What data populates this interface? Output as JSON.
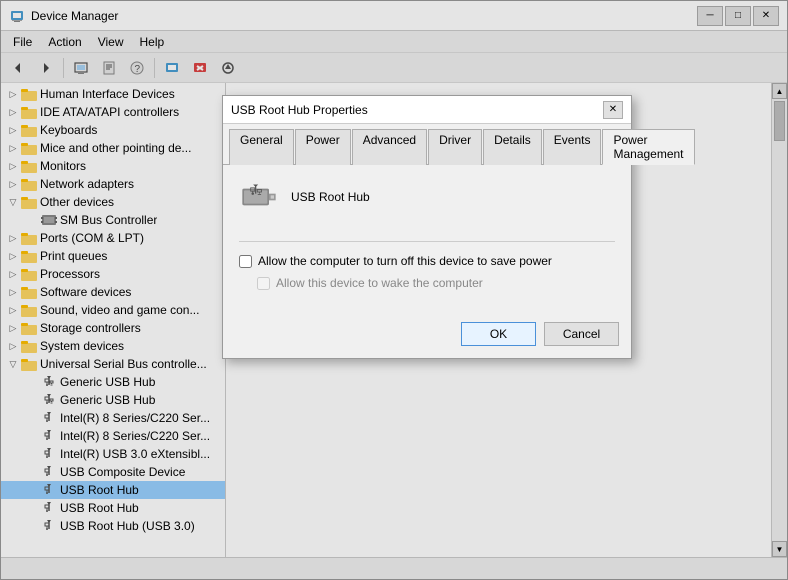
{
  "window": {
    "title": "Device Manager",
    "controls": {
      "minimize": "─",
      "maximize": "□",
      "close": "✕"
    }
  },
  "menu": {
    "items": [
      "File",
      "Action",
      "View",
      "Help"
    ]
  },
  "toolbar": {
    "buttons": [
      "◀",
      "▶",
      "📋",
      "📋",
      "❓",
      "📋",
      "📋",
      "🖥",
      "✕",
      "⬇"
    ]
  },
  "tree": {
    "items": [
      {
        "label": "Human Interface Devices",
        "indent": 1,
        "expanded": false,
        "icon": "folder"
      },
      {
        "label": "IDE ATA/ATAPI controllers",
        "indent": 1,
        "expanded": false,
        "icon": "folder"
      },
      {
        "label": "Keyboards",
        "indent": 1,
        "expanded": false,
        "icon": "folder"
      },
      {
        "label": "Mice and other pointing de...",
        "indent": 1,
        "expanded": false,
        "icon": "folder"
      },
      {
        "label": "Monitors",
        "indent": 1,
        "expanded": false,
        "icon": "folder"
      },
      {
        "label": "Network adapters",
        "indent": 1,
        "expanded": false,
        "icon": "folder"
      },
      {
        "label": "Other devices",
        "indent": 1,
        "expanded": true,
        "icon": "folder"
      },
      {
        "label": "SM Bus Controller",
        "indent": 2,
        "expanded": false,
        "icon": "device"
      },
      {
        "label": "Ports (COM & LPT)",
        "indent": 1,
        "expanded": false,
        "icon": "folder"
      },
      {
        "label": "Print queues",
        "indent": 1,
        "expanded": false,
        "icon": "folder"
      },
      {
        "label": "Processors",
        "indent": 1,
        "expanded": false,
        "icon": "folder"
      },
      {
        "label": "Software devices",
        "indent": 1,
        "expanded": false,
        "icon": "folder"
      },
      {
        "label": "Sound, video and game con...",
        "indent": 1,
        "expanded": false,
        "icon": "folder"
      },
      {
        "label": "Storage controllers",
        "indent": 1,
        "expanded": false,
        "icon": "folder"
      },
      {
        "label": "System devices",
        "indent": 1,
        "expanded": false,
        "icon": "folder"
      },
      {
        "label": "Universal Serial Bus controlle...",
        "indent": 1,
        "expanded": true,
        "icon": "folder"
      },
      {
        "label": "Generic USB Hub",
        "indent": 2,
        "expanded": false,
        "icon": "usb"
      },
      {
        "label": "Generic USB Hub",
        "indent": 2,
        "expanded": false,
        "icon": "usb"
      },
      {
        "label": "Intel(R) 8 Series/C220 Ser...",
        "indent": 2,
        "expanded": false,
        "icon": "usb"
      },
      {
        "label": "Intel(R) 8 Series/C220 Ser...",
        "indent": 2,
        "expanded": false,
        "icon": "usb"
      },
      {
        "label": "Intel(R) USB 3.0 eXtensibl...",
        "indent": 2,
        "expanded": false,
        "icon": "usb"
      },
      {
        "label": "USB Composite Device",
        "indent": 2,
        "expanded": false,
        "icon": "usb"
      },
      {
        "label": "USB Root Hub",
        "indent": 2,
        "expanded": false,
        "icon": "usb",
        "selected": true
      },
      {
        "label": "USB Root Hub",
        "indent": 2,
        "expanded": false,
        "icon": "usb"
      },
      {
        "label": "USB Root Hub (USB 3.0)",
        "indent": 2,
        "expanded": false,
        "icon": "usb"
      }
    ]
  },
  "dialog": {
    "title": "USB Root Hub Properties",
    "tabs": [
      "General",
      "Power",
      "Advanced",
      "Driver",
      "Details",
      "Events",
      "Power Management"
    ],
    "active_tab": "Power Management",
    "device_name": "USB Root Hub",
    "checkboxes": [
      {
        "id": "cb1",
        "label": "Allow the computer to turn off this device to save power",
        "checked": false,
        "enabled": true
      },
      {
        "id": "cb2",
        "label": "Allow this device to wake the computer",
        "checked": false,
        "enabled": false
      }
    ],
    "buttons": {
      "ok": "OK",
      "cancel": "Cancel"
    }
  }
}
